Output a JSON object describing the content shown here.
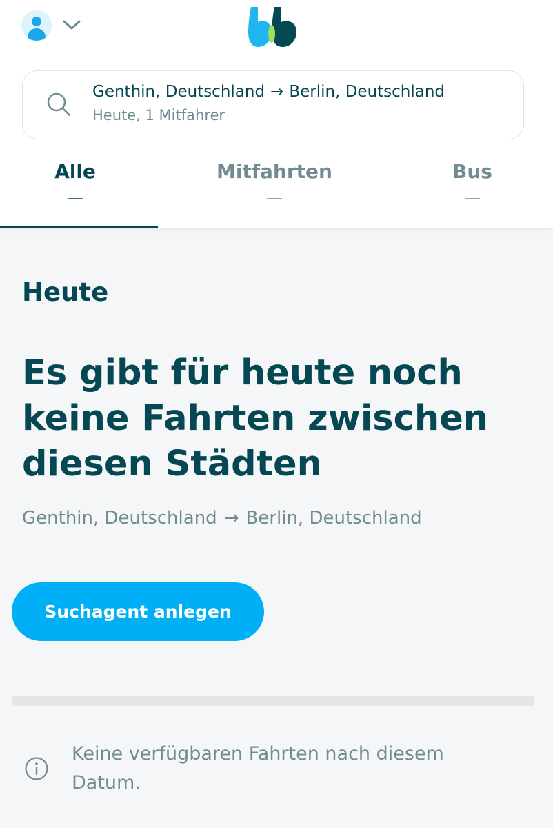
{
  "header": {
    "avatar_icon": "user-avatar-icon",
    "chevron_icon": "chevron-down-icon",
    "logo_icon": "blablacar-logo-icon"
  },
  "search": {
    "icon": "search-icon",
    "from": "Genthin, Deutschland",
    "arrow": "→",
    "to": "Berlin, Deutschland",
    "details": "Heute, 1 Mitfahrer"
  },
  "tabs": [
    {
      "label": "Alle",
      "marker": "—",
      "active": true
    },
    {
      "label": "Mitfahrten",
      "marker": "—",
      "active": false
    },
    {
      "label": "Bus",
      "marker": "—",
      "active": false
    }
  ],
  "content": {
    "day_heading": "Heute",
    "message": "Es gibt für heute noch keine Fahrten zwischen diesen Städten",
    "route_from": "Genthin, Deutschland",
    "route_arrow": "→",
    "route_to": "Berlin, Deutschland",
    "cta_label": "Suchagent anlegen",
    "info_icon": "info-icon",
    "info_text": "Keine verfügbaren Fahrten nach diesem Datum."
  },
  "colors": {
    "primary_text": "#054752",
    "secondary_text": "#708c91",
    "accent": "#00aff5",
    "background": "#f5f6f8"
  }
}
